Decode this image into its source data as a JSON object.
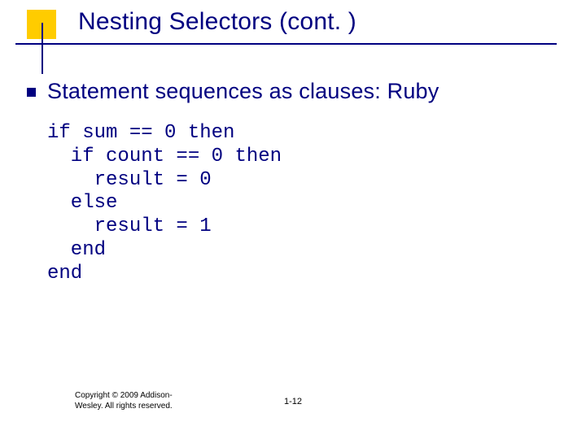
{
  "slide": {
    "title": "Nesting Selectors (cont. )",
    "bullet": "Statement sequences as clauses: Ruby",
    "code": "if sum == 0 then\n  if count == 0 then\n    result = 0\n  else\n    result = 1\n  end\nend",
    "footer_copyright": "Copyright © 2009 Addison-Wesley. All rights reserved.",
    "page_number": "1-12"
  }
}
